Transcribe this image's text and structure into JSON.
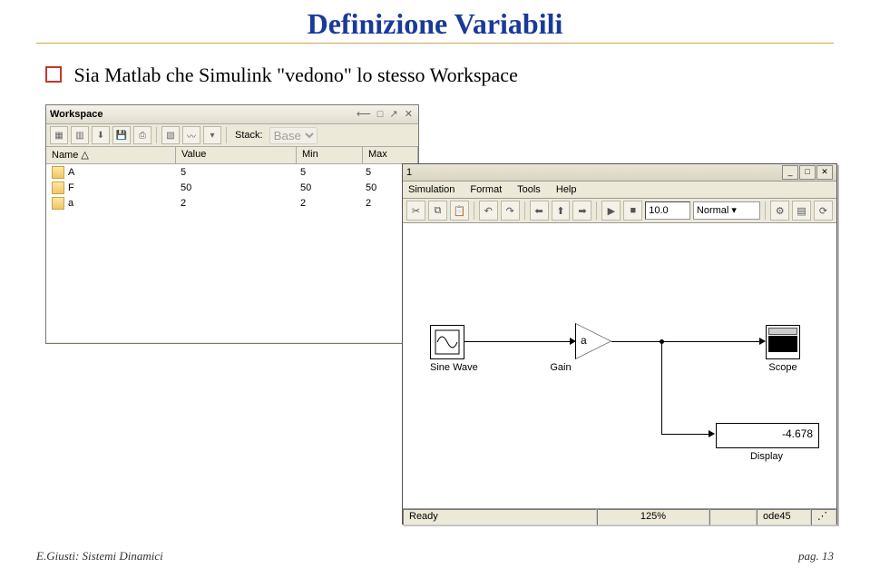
{
  "title": "Definizione Variabili",
  "bullet": "Sia Matlab che Simulink \"vedono\" lo stesso Workspace",
  "workspace": {
    "title": "Workspace",
    "sysbuttons": "⟵ □ ↗ ✕",
    "stack_label": "Stack:",
    "stack_value": "Base",
    "headers": {
      "name": "Name △",
      "value": "Value",
      "min": "Min",
      "max": "Max"
    },
    "rows": [
      {
        "name": "A",
        "value": "5",
        "min": "5",
        "max": "5"
      },
      {
        "name": "F",
        "value": "50",
        "min": "50",
        "max": "50"
      },
      {
        "name": "a",
        "value": "2",
        "min": "2",
        "max": "2"
      }
    ]
  },
  "simulink": {
    "title_suffix": "1",
    "menus": [
      "Simulation",
      "Format",
      "Tools",
      "Help"
    ],
    "stop_time": "10.0",
    "mode": "Normal",
    "blocks": {
      "sine": "Sine Wave",
      "gain": "Gain",
      "gain_param": "a",
      "scope": "Scope",
      "display": "Display",
      "display_value": "-4.678"
    },
    "status": {
      "ready": "Ready",
      "zoom": "125%",
      "solver": "ode45"
    }
  },
  "footer": {
    "left": "E.Giusti: Sistemi Dinamici",
    "right": "pag. 13"
  }
}
